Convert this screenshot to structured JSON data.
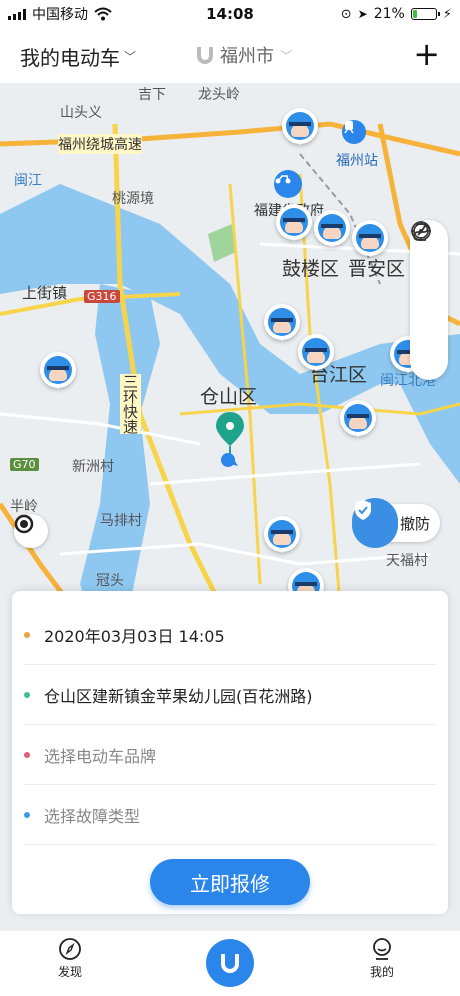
{
  "status_bar": {
    "carrier": "中国移动",
    "time": "14:08",
    "battery": "21%",
    "battery_level": 0.21
  },
  "header": {
    "vehicle_selector": "我的电动车",
    "city": "福州市",
    "add_icon": "plus-icon"
  },
  "map": {
    "places": [
      "山头义",
      "吉下",
      "龙头岭",
      "福州绕城高速",
      "福州站",
      "闽江",
      "桃源境",
      "福建省政府",
      "鼓楼区",
      "晋安区",
      "上街镇",
      "G316",
      "仓山区",
      "台江区",
      "闽江北港",
      "三环快速",
      "新洲村",
      "G70",
      "马排村",
      "半岭",
      "冠头",
      "天福村"
    ],
    "guard_label": "撤防"
  },
  "form": {
    "datetime": "2020年03月03日 14:05",
    "location": "仓山区建新镇金苹果幼儿园(百花洲路)",
    "brand_placeholder": "选择电动车品牌",
    "fault_placeholder": "选择故障类型",
    "submit_label": "立即报修",
    "dot_colors": {
      "datetime": "#f0a040",
      "location": "#3cc18a",
      "brand": "#e0607a",
      "fault": "#3a9be8"
    }
  },
  "tabbar": {
    "discover_label": "发现",
    "mine_label": "我的"
  },
  "colors": {
    "primary": "#2a86ea",
    "water": "#8ec8f0",
    "road": "#f7d44a"
  }
}
